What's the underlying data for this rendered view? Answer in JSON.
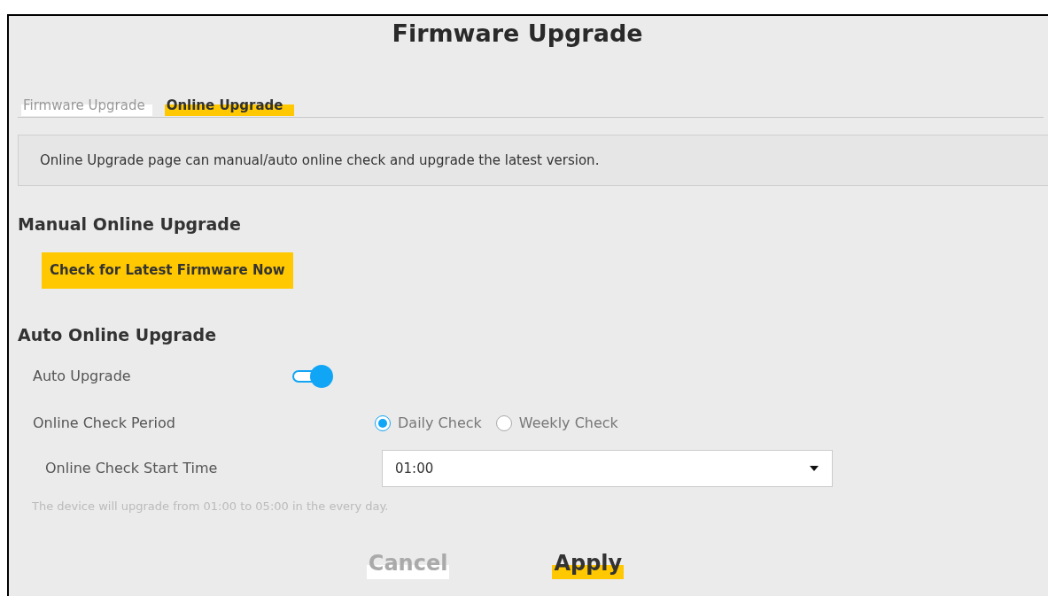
{
  "title": "Firmware Upgrade",
  "tabs": [
    {
      "label": "Firmware Upgrade",
      "selected": false
    },
    {
      "label": "Online Upgrade",
      "selected": true
    }
  ],
  "description": "Online Upgrade page can manual/auto online check and upgrade the latest version.",
  "manual": {
    "heading": "Manual Online Upgrade",
    "button": "Check for Latest Firmware Now"
  },
  "auto": {
    "heading": "Auto Online Upgrade",
    "auto_upgrade": {
      "label": "Auto Upgrade",
      "on": true
    },
    "period": {
      "label": "Online Check Period",
      "options": [
        {
          "label": "Daily Check",
          "selected": true
        },
        {
          "label": "Weekly Check",
          "selected": false
        }
      ]
    },
    "start_time": {
      "label": "Online Check Start Time",
      "value": "01:00"
    },
    "note": "The device will upgrade from 01:00 to 05:00 in the every day."
  },
  "buttons": [
    {
      "label": "Cancel",
      "kind": "secondary"
    },
    {
      "label": "Apply",
      "kind": "primary"
    }
  ]
}
